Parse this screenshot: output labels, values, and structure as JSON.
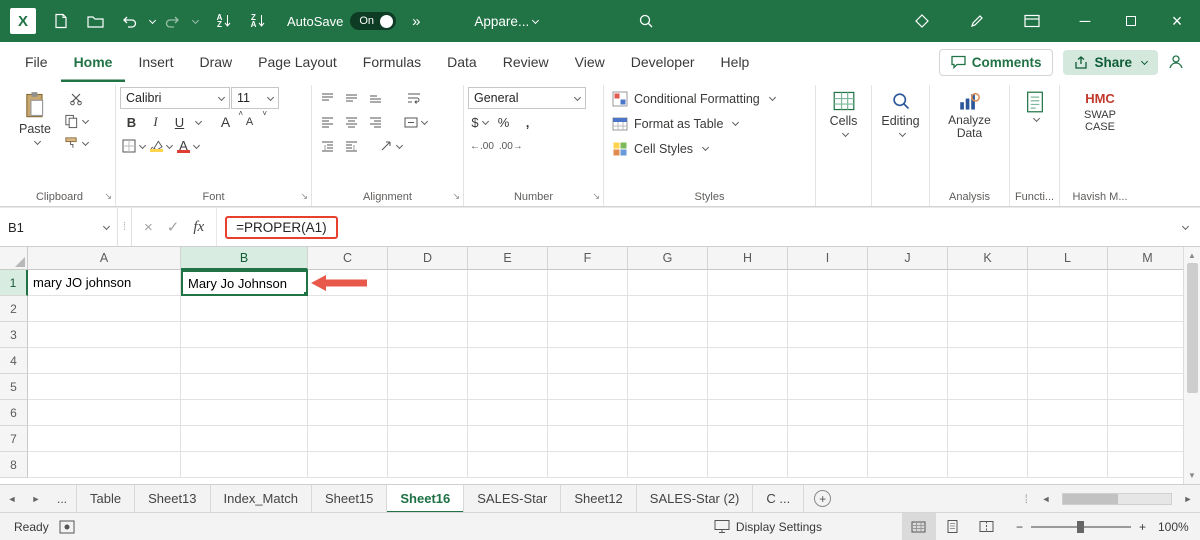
{
  "colors": {
    "excel_green": "#217346",
    "annotation_red": "#e8402f",
    "arrow_red": "#e8594b"
  },
  "titlebar": {
    "autosave_label": "AutoSave",
    "autosave_state": "On",
    "more": "»",
    "workbook_name": "Appare...",
    "sort": {
      "a": "A",
      "z": "Z"
    }
  },
  "menu": {
    "tabs": [
      "File",
      "Home",
      "Insert",
      "Draw",
      "Page Layout",
      "Formulas",
      "Data",
      "Review",
      "View",
      "Developer",
      "Help"
    ],
    "active_tab": "Home",
    "comments": "Comments",
    "share": "Share"
  },
  "ribbon": {
    "clipboard": {
      "paste": "Paste",
      "group": "Clipboard"
    },
    "font": {
      "name": "Calibri",
      "size": "11",
      "bold": "B",
      "italic": "I",
      "underline": "U",
      "grow": "A",
      "shrink": "A",
      "group": "Font"
    },
    "alignment": {
      "group": "Alignment"
    },
    "number": {
      "format": "General",
      "currency": "$",
      "percent": "%",
      "comma": ",",
      "increase_decimal": "←.00",
      "decrease_decimal": ".00→",
      "group": "Number"
    },
    "styles": {
      "conditional": "Conditional Formatting",
      "format_table": "Format as Table",
      "cell_styles": "Cell Styles",
      "group": "Styles"
    },
    "cells": {
      "label": "Cells"
    },
    "editing": {
      "label": "Editing"
    },
    "analysis": {
      "button": "Analyze Data",
      "group": "Analysis"
    },
    "functions": {
      "group": "Functi..."
    },
    "custom": {
      "hmc": "HMC",
      "swap": "SWAP CASE",
      "group": "Havish M..."
    }
  },
  "formula_bar": {
    "name_box": "B1",
    "fx": "fx",
    "formula": "=PROPER(A1)"
  },
  "grid": {
    "columns": [
      "A",
      "B",
      "C",
      "D",
      "E",
      "F",
      "G",
      "H",
      "I",
      "J",
      "K",
      "L",
      "M"
    ],
    "rows": [
      "1",
      "2",
      "3",
      "4",
      "5",
      "6",
      "7",
      "8"
    ],
    "selected_cell": "B1",
    "cells": {
      "A1": "mary JO johnson",
      "B1": "Mary Jo Johnson"
    }
  },
  "sheet_tabs": {
    "tabs": [
      "Table",
      "Sheet13",
      "Index_Match",
      "Sheet15",
      "Sheet16",
      "SALES-Star",
      "Sheet12",
      "SALES-Star (2)",
      "C ..."
    ],
    "active": "Sheet16"
  },
  "status_bar": {
    "ready": "Ready",
    "display_settings": "Display Settings",
    "zoom": "100%"
  },
  "icons": {
    "close": "×",
    "minimize": "─",
    "check": "✓",
    "cancel": "×",
    "up": "▲",
    "down": "▼",
    "left": "◄",
    "right": "►",
    "ellipsis": "...",
    "dots": "⁞",
    "plus": "+",
    "minus": "−"
  }
}
